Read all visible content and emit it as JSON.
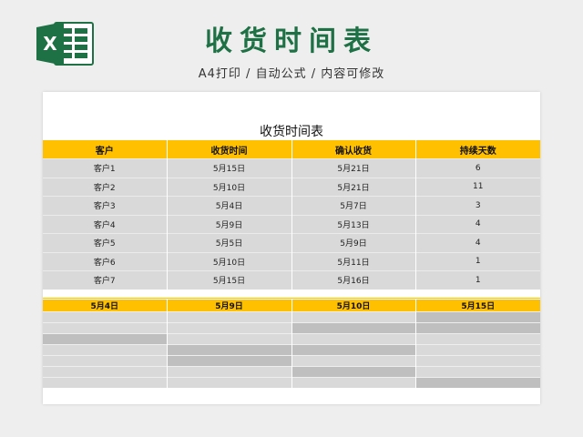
{
  "header": {
    "title": "收货时间表",
    "subtitle": "A4打印 / 自动公式 / 内容可修改",
    "logo_icon": "excel-icon",
    "brand_color": "#1e7145"
  },
  "sheet": {
    "title": "收货时间表",
    "accent_color": "#ffc000",
    "columns": [
      "客户",
      "收货时间",
      "确认收货",
      "持续天数"
    ],
    "rows": [
      [
        "客户1",
        "5月15日",
        "5月21日",
        "6"
      ],
      [
        "客户2",
        "5月10日",
        "5月21日",
        "11"
      ],
      [
        "客户3",
        "5月4日",
        "5月7日",
        "3"
      ],
      [
        "客户4",
        "5月9日",
        "5月13日",
        "4"
      ],
      [
        "客户5",
        "5月5日",
        "5月9日",
        "4"
      ],
      [
        "客户6",
        "5月10日",
        "5月11日",
        "1"
      ],
      [
        "客户7",
        "5月15日",
        "5月16日",
        "1"
      ]
    ]
  },
  "gantt": {
    "headers": [
      "5月4日",
      "5月9日",
      "5月10日",
      "5月15日"
    ],
    "bar_color": "#bfbfbf",
    "rows": [
      [
        0,
        0,
        0,
        1
      ],
      [
        0,
        0,
        1,
        1
      ],
      [
        1,
        0,
        0,
        0
      ],
      [
        0,
        1,
        1,
        0
      ],
      [
        0,
        1,
        0,
        0
      ],
      [
        0,
        0,
        1,
        0
      ],
      [
        0,
        0,
        0,
        1
      ]
    ]
  }
}
